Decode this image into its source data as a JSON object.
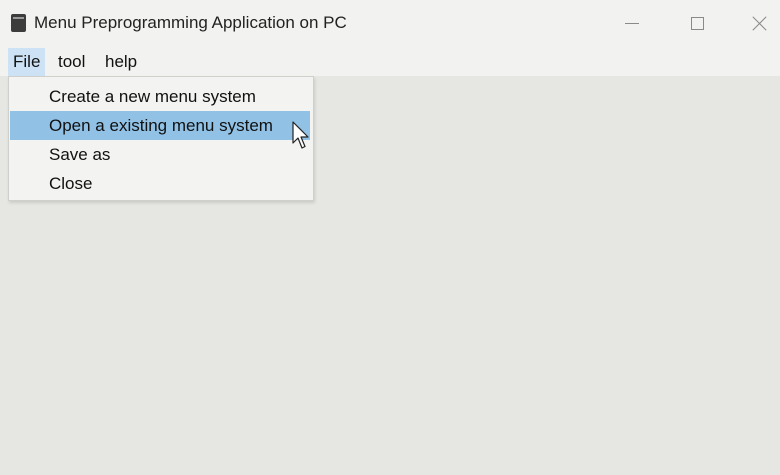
{
  "window": {
    "title": "Menu Preprogramming Application on PC",
    "icon": "app-icon",
    "controls": [
      "minimize-icon",
      "maximize-icon",
      "close-icon"
    ]
  },
  "menubar": {
    "items": [
      {
        "label": "File",
        "active": true
      },
      {
        "label": "tool",
        "active": false
      },
      {
        "label": "help",
        "active": false
      }
    ]
  },
  "file_menu": {
    "items": [
      {
        "label": "Create a new menu system",
        "highlighted": false
      },
      {
        "label": "Open a existing menu system",
        "highlighted": true
      },
      {
        "label": "Save as",
        "highlighted": false
      },
      {
        "label": "Close",
        "highlighted": false
      }
    ]
  },
  "colors": {
    "highlight": "#91c2e6",
    "active_menu": "#cde3f5",
    "background": "#e6e7e3"
  },
  "cursor": {
    "icon": "mouse-pointer-icon"
  }
}
